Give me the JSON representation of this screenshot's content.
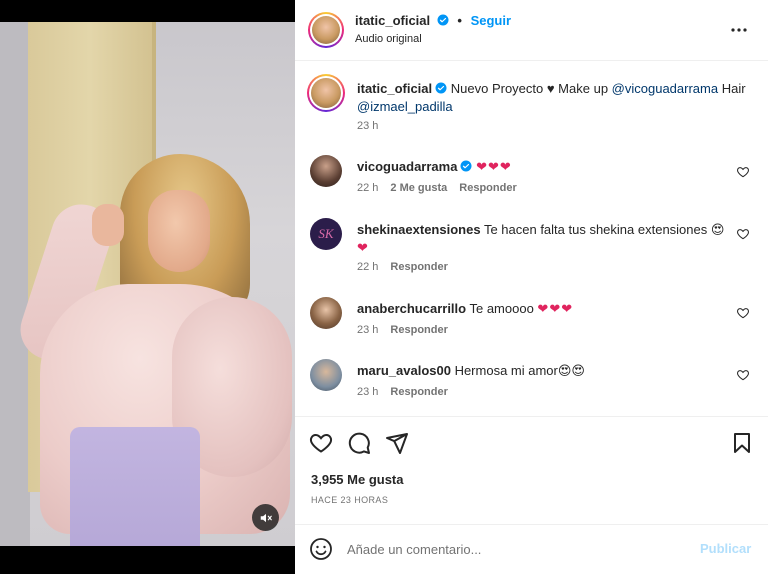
{
  "post": {
    "author": "itatic_oficial",
    "follow_label": "Seguir",
    "audio_label": "Audio original",
    "separator": "•"
  },
  "caption": {
    "username": "itatic_oficial",
    "text_before": " Nuevo Proyecto ♥ Make up ",
    "mention1": "@vicoguadarrama",
    "text_mid": " Hair ",
    "mention2": "@izmael_padilla",
    "time": "23 h"
  },
  "comments": [
    {
      "username": "vicoguadarrama",
      "text": "",
      "emoji": "❤❤❤",
      "time": "22 h",
      "likes": "2 Me gusta",
      "reply": "Responder"
    },
    {
      "username": "shekinaextensiones",
      "text": " Te hacen falta tus shekina extensiones ",
      "emoji": "😍",
      "emoji2": "❤",
      "time": "22 h",
      "reply": "Responder",
      "avatar_text": "SK"
    },
    {
      "username": "anaberchucarrillo",
      "text": " Te amoooo ",
      "emoji": "❤❤❤",
      "time": "23 h",
      "reply": "Responder"
    },
    {
      "username": "maru_avalos00",
      "text": " Hermosa mi amor",
      "emoji": "😍😍",
      "time": "23 h",
      "reply": "Responder"
    }
  ],
  "stats": {
    "likes": "3,955 Me gusta",
    "posted_ago": "HACE 23 HORAS"
  },
  "composer": {
    "placeholder": "Añade un comentario...",
    "publish": "Publicar"
  },
  "colors": {
    "accent": "#0095f6",
    "publish_disabled": "#b2dffc",
    "verified": "#0095f6",
    "heart_red": "#e0245e"
  },
  "icons": [
    "verified-icon",
    "more-icon",
    "mute-icon",
    "heart-icon",
    "comment-icon",
    "share-icon",
    "bookmark-icon",
    "emoji-icon"
  ]
}
